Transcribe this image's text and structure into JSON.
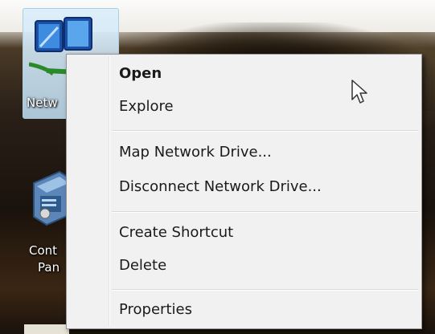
{
  "desktop": {
    "network_icon": {
      "label": "Netw",
      "icon": "network-icon"
    },
    "control_panel_icon": {
      "label_line1": "Cont",
      "label_line2": "Pan",
      "icon": "control-panel-icon"
    }
  },
  "context_menu": {
    "items": [
      {
        "label": "Open",
        "default": true
      },
      {
        "label": "Explore"
      },
      {
        "label": "Map Network Drive..."
      },
      {
        "label": "Disconnect Network Drive..."
      },
      {
        "label": "Create Shortcut"
      },
      {
        "label": "Delete"
      },
      {
        "label": "Properties"
      }
    ]
  },
  "colors": {
    "menu_background": "#f1f1f1",
    "selection_tile": "#cfe6f6",
    "menu_text": "#1a1a1a"
  },
  "cursor": {
    "icon": "mouse-pointer-icon"
  }
}
